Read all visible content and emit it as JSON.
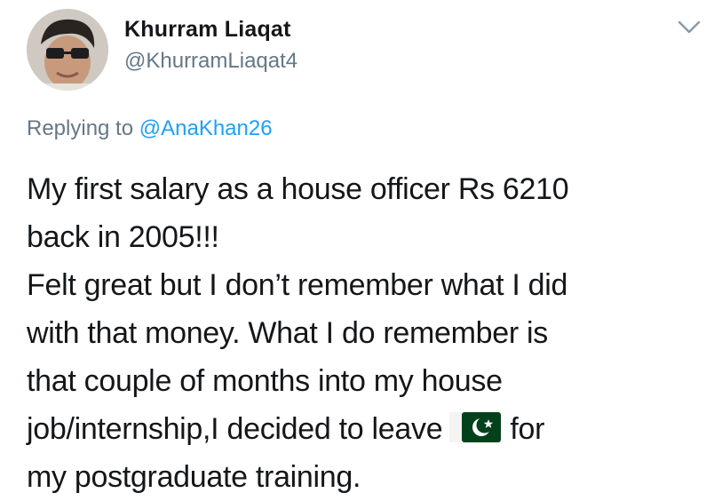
{
  "tweet": {
    "author": {
      "display_name": "Khurram Liaqat",
      "handle": "@KhurramLiaqat4",
      "avatar_icon": "profile-photo"
    },
    "menu_icon": "chevron-down-icon",
    "reply": {
      "prefix": "Replying to",
      "mention": "@AnaKhan26"
    },
    "body": {
      "line1": "My first salary as a house officer Rs 6210",
      "line2": "back in 2005!!!",
      "line3": "Felt great but I don’t remember what I did",
      "line4": "with that money. What I do remember is",
      "line5": "that couple of months into my house",
      "line6_before_flag": "job/internship,I decided to leave",
      "line6_after_flag": "for",
      "line7": "my postgraduate training.",
      "flag_emoji": "pakistan-flag"
    }
  },
  "colors": {
    "text": "#14171a",
    "secondary": "#657786",
    "link": "#1da1f2",
    "flag_green": "#01411c"
  }
}
